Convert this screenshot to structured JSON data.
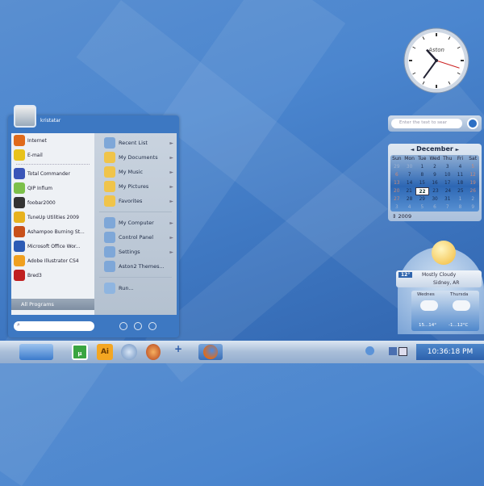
{
  "start_menu": {
    "user": "kristatar",
    "pinned": [
      {
        "label": "Internet",
        "icon": "firefox-icon",
        "color": "#e06a1a"
      },
      {
        "label": "E-mail",
        "icon": "batman-mail-icon",
        "color": "#e8c21a"
      }
    ],
    "recent": [
      {
        "label": "Total Commander",
        "icon": "floppy-icon",
        "color": "#3a55b8"
      },
      {
        "label": "QIP Infium",
        "icon": "qip-icon",
        "color": "#7cc04a"
      },
      {
        "label": "foobar2000",
        "icon": "skull-icon",
        "color": "#333333"
      },
      {
        "label": "TuneUp Utilities 2009",
        "icon": "tuneup-icon",
        "color": "#e7b21e"
      },
      {
        "label": "Ashampoo Burning St...",
        "icon": "burning-icon",
        "color": "#c8501a"
      },
      {
        "label": "Microsoft Office Wor...",
        "icon": "word-icon",
        "color": "#2c5bb5"
      },
      {
        "label": "Adobe Illustrator CS4",
        "icon": "illustrator-icon",
        "color": "#f0a020"
      },
      {
        "label": "Bred3",
        "icon": "document-icon",
        "color": "#c02020"
      }
    ],
    "all_programs": "All Programs",
    "places": [
      {
        "label": "Recent List",
        "icon": "recent-icon",
        "arrow": true
      },
      {
        "label": "My Documents",
        "icon": "folder-icon",
        "arrow": true
      },
      {
        "label": "My Music",
        "icon": "folder-icon",
        "arrow": true
      },
      {
        "label": "My Pictures",
        "icon": "folder-icon",
        "arrow": true
      },
      {
        "label": "Favorites",
        "icon": "folder-icon",
        "arrow": true
      }
    ],
    "system": [
      {
        "label": "My Computer",
        "icon": "computer-icon",
        "arrow": true
      },
      {
        "label": "Control Panel",
        "icon": "control-panel-icon",
        "arrow": true
      },
      {
        "label": "Settings",
        "icon": "settings-icon",
        "arrow": true
      },
      {
        "label": "Aston2 Themes...",
        "icon": "themes-icon",
        "arrow": false
      }
    ],
    "run": "Run...",
    "arrow_glyph": "►"
  },
  "search_widget": {
    "placeholder": "Enter the text to sear"
  },
  "calendar": {
    "month": "December",
    "year": "2009",
    "prev": "◄",
    "next": "►",
    "spin": "⇕",
    "days": [
      "Sun",
      "Mon",
      "Tue",
      "Wed",
      "Thu",
      "Fri",
      "Sat"
    ],
    "weeks": [
      [
        "29",
        "30",
        "1",
        "2",
        "3",
        "4",
        "5"
      ],
      [
        "6",
        "7",
        "8",
        "9",
        "10",
        "11",
        "12"
      ],
      [
        "13",
        "14",
        "15",
        "16",
        "17",
        "18",
        "19"
      ],
      [
        "20",
        "21",
        "22",
        "23",
        "24",
        "25",
        "26"
      ],
      [
        "27",
        "28",
        "29",
        "30",
        "31",
        "1",
        "2"
      ],
      [
        "3",
        "4",
        "5",
        "6",
        "7",
        "8",
        "9"
      ]
    ],
    "selected": "22"
  },
  "clock": {
    "brand": "Aston",
    "hour": 10,
    "minute": 36,
    "second": 18
  },
  "weather": {
    "temp": "12°",
    "condition": "Mostly Cloudy",
    "location": "Sidney, AR",
    "forecast": [
      {
        "day": "Wednes",
        "range": "15...14°"
      },
      {
        "day": "Thursda",
        "range": "-1...12°C"
      }
    ]
  },
  "taskbar": {
    "time": "10:36:18 PM",
    "plus": "+",
    "utorrent": "µ",
    "ai": "Ai"
  }
}
